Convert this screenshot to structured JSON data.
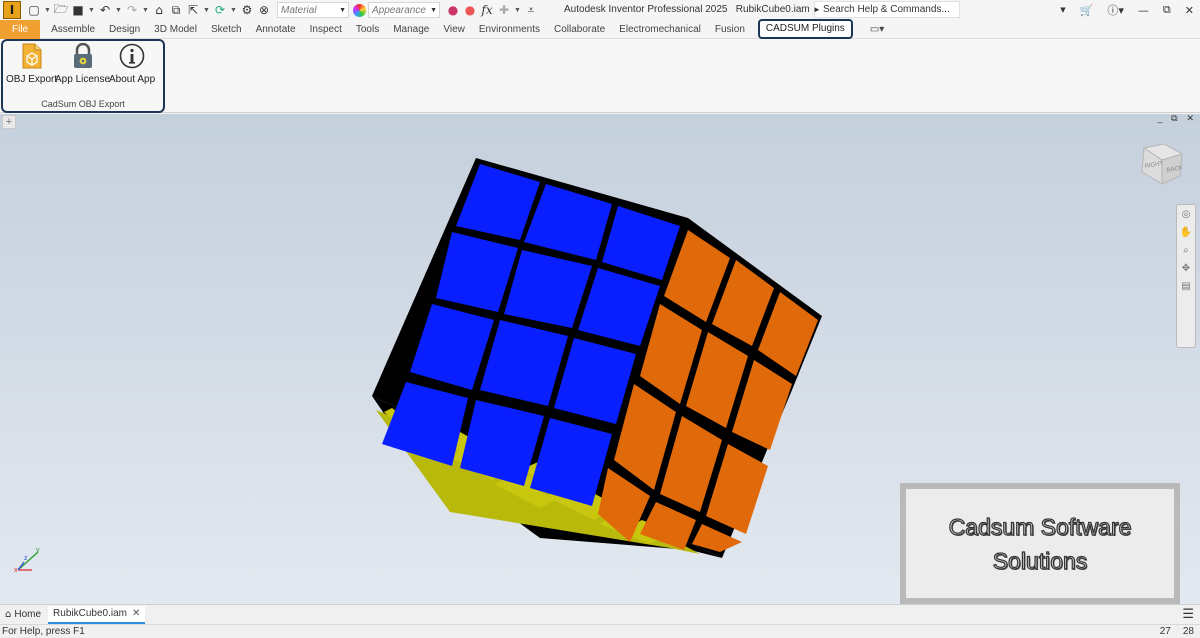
{
  "titlebar": {
    "app_logo_letter": "I",
    "material_placeholder": "Material",
    "appearance_placeholder": "Appearance",
    "app_title": "Autodesk Inventor Professional 2025",
    "doc_title": "RubikCube0.iam",
    "search_placeholder": "Search Help & Commands...",
    "window_controls": [
      "minimize",
      "restore",
      "close"
    ]
  },
  "ribbon_tabs": [
    {
      "label": "File"
    },
    {
      "label": "Assemble"
    },
    {
      "label": "Design"
    },
    {
      "label": "3D Model"
    },
    {
      "label": "Sketch"
    },
    {
      "label": "Annotate"
    },
    {
      "label": "Inspect"
    },
    {
      "label": "Tools"
    },
    {
      "label": "Manage"
    },
    {
      "label": "View"
    },
    {
      "label": "Environments"
    },
    {
      "label": "Collaborate"
    },
    {
      "label": "Electromechanical"
    },
    {
      "label": "Fusion"
    },
    {
      "label": "CADSUM Plugins"
    }
  ],
  "panel": {
    "title": "CadSum OBJ Export",
    "buttons": [
      {
        "label": "OBJ Export",
        "icon": "obj-export-icon"
      },
      {
        "label": "App License",
        "icon": "lock-icon"
      },
      {
        "label": "About App",
        "icon": "info-icon"
      }
    ]
  },
  "viewport": {
    "viewcube_faces": [
      "RIGHT",
      "BACK"
    ],
    "watermark_lines": [
      "Cadsum Software",
      "Solutions"
    ],
    "triad_axes": [
      "x",
      "y",
      "z"
    ]
  },
  "doc_tabs": [
    {
      "label": "Home"
    },
    {
      "label": "RubikCube0.iam"
    }
  ],
  "status": {
    "help_text": "For Help, press F1",
    "num1": "27",
    "num2": "28"
  },
  "colors": {
    "face_top": "#0a1fff",
    "face_right": "#e06a0a",
    "face_bottom": "#c8c70e",
    "accent_file_tab": "#f0a030",
    "highlight_border": "#1d3557"
  }
}
